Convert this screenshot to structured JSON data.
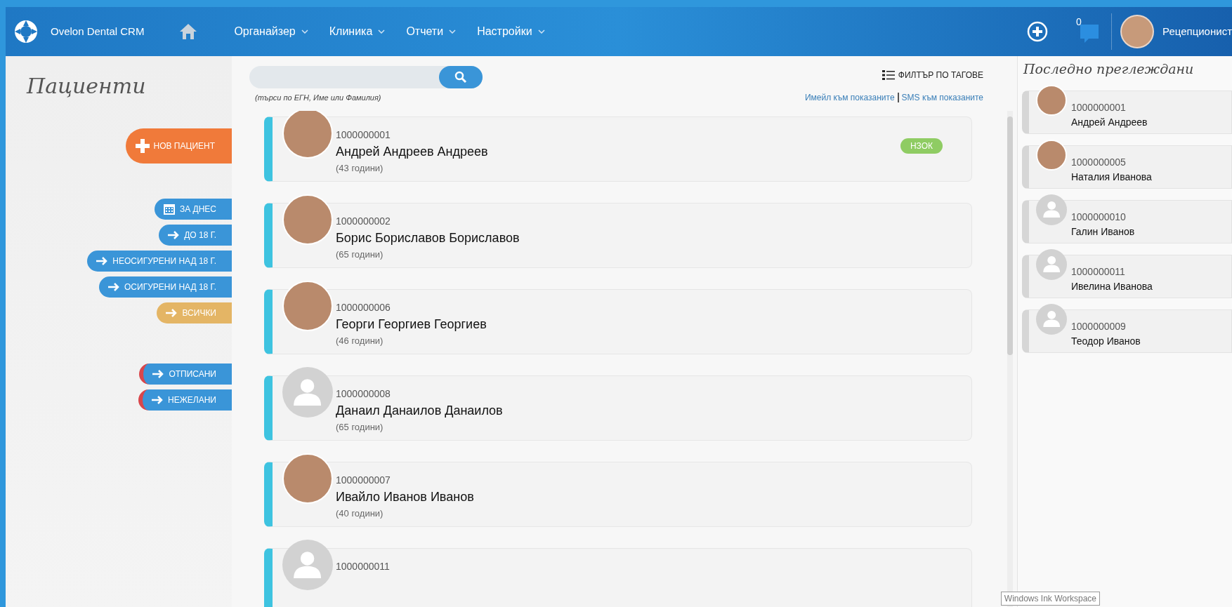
{
  "header": {
    "logo_text": "Ovelon Dental CRM",
    "nav": [
      {
        "label": "Органайзер"
      },
      {
        "label": "Клиника"
      },
      {
        "label": "Отчети"
      },
      {
        "label": "Настройки"
      }
    ],
    "notifications_count": "0",
    "user": {
      "name": "Рецепционист"
    }
  },
  "sidebar": {
    "title": "Пациенти",
    "buttons": [
      {
        "label": "НОВ ПАЦИЕНТ",
        "kind": "plus",
        "color": "#f07a3a",
        "flagged": false
      },
      {
        "label": "ЗА ДНЕС",
        "kind": "calendar",
        "color": "#3a95d8",
        "flagged": false
      },
      {
        "label": "ДО 18 Г.",
        "kind": "arrow",
        "color": "#3a95d8",
        "flagged": false
      },
      {
        "label": "НЕОСИГУРЕНИ НАД 18 Г.",
        "kind": "arrow",
        "color": "#3a95d8",
        "flagged": false
      },
      {
        "label": "ОСИГУРЕНИ НАД 18 Г.",
        "kind": "arrow",
        "color": "#3a95d8",
        "flagged": false
      },
      {
        "label": "ВСИЧКИ",
        "kind": "arrow",
        "color": "#e4b565",
        "flagged": false
      },
      {
        "label": "ОТПИСАНИ",
        "kind": "arrow",
        "color": "#3a95d8",
        "flagged": true
      },
      {
        "label": "НЕЖЕЛАНИ",
        "kind": "arrow",
        "color": "#3a95d8",
        "flagged": true
      }
    ]
  },
  "search": {
    "hint": "(търси по ЕГН, Име или Фамилия)",
    "filter_label": "ФИЛТЪР ПО ТАГОВЕ",
    "links": [
      "Имейл към показаните",
      "SMS към показаните"
    ]
  },
  "patients": [
    {
      "id": "1000000001",
      "name": "Андрей Андреев Андреев",
      "age": "(43 години)",
      "has_photo": true,
      "tag": "НЗОК"
    },
    {
      "id": "1000000002",
      "name": "Борис Бориславов Бориславов",
      "age": "(65 години)",
      "has_photo": true
    },
    {
      "id": "1000000006",
      "name": "Георги Георгиев Георгиев",
      "age": "(46 години)",
      "has_photo": true
    },
    {
      "id": "1000000008",
      "name": "Данаил Данаилов Данаилов",
      "age": "(65 години)",
      "has_photo": false
    },
    {
      "id": "1000000007",
      "name": "Ивайло Иванов Иванов",
      "age": "(40 години)",
      "has_photo": true
    },
    {
      "id": "1000000011",
      "has_photo": false
    }
  ],
  "recent": {
    "title": "Последно преглеждани",
    "items": [
      {
        "id": "1000000001",
        "name": "Андрей Андреев",
        "has_photo": true
      },
      {
        "id": "1000000005",
        "name": "Наталия Иванова",
        "has_photo": true
      },
      {
        "id": "1000000010",
        "name": "Галин Иванов",
        "has_photo": false
      },
      {
        "id": "1000000011",
        "name": "Ивелина Иванова",
        "has_photo": false
      },
      {
        "id": "1000000009",
        "name": "Теодор Иванов",
        "has_photo": false
      }
    ]
  },
  "tooltip": "Windows Ink Workspace"
}
